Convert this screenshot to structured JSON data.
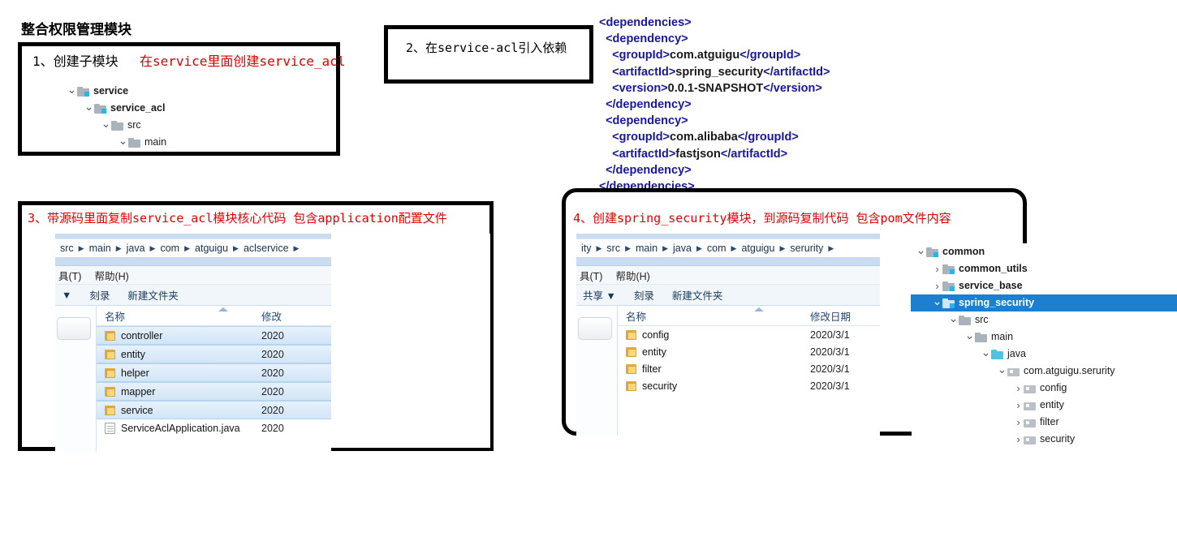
{
  "page_title": "整合权限管理模块",
  "box1": {
    "title": "1、创建子模块",
    "note": "在service里面创建service_acl",
    "tree": [
      {
        "label": "service",
        "indent": 0,
        "arrow": "v",
        "icon": "module-folder-icon",
        "bold": true
      },
      {
        "label": "service_acl",
        "indent": 1,
        "arrow": "v",
        "icon": "module-folder-icon",
        "bold": true
      },
      {
        "label": "src",
        "indent": 2,
        "arrow": "v",
        "icon": "folder-icon",
        "bold": false
      },
      {
        "label": "main",
        "indent": 3,
        "arrow": "v",
        "icon": "folder-icon",
        "bold": false
      }
    ]
  },
  "box2": {
    "title": "2、在service-acl引入依赖"
  },
  "xml": {
    "lines": [
      [
        {
          "t": "tag",
          "v": "<dependencies>"
        }
      ],
      [
        {
          "t": "sp",
          "v": "  "
        },
        {
          "t": "tag",
          "v": "<dependency>"
        }
      ],
      [
        {
          "t": "sp",
          "v": "    "
        },
        {
          "t": "tag",
          "v": "<groupId>"
        },
        {
          "t": "val",
          "v": "com.atguigu"
        },
        {
          "t": "tag",
          "v": "</groupId>"
        }
      ],
      [
        {
          "t": "sp",
          "v": "    "
        },
        {
          "t": "tag",
          "v": "<artifactId>"
        },
        {
          "t": "val",
          "v": "spring_security"
        },
        {
          "t": "tag",
          "v": "</artifactId>"
        }
      ],
      [
        {
          "t": "sp",
          "v": "    "
        },
        {
          "t": "tag",
          "v": "<version>"
        },
        {
          "t": "val",
          "v": "0.0.1-SNAPSHOT"
        },
        {
          "t": "tag",
          "v": "</version>"
        }
      ],
      [
        {
          "t": "sp",
          "v": "  "
        },
        {
          "t": "tag",
          "v": "</dependency>"
        }
      ],
      [
        {
          "t": "sp",
          "v": "  "
        },
        {
          "t": "tag",
          "v": "<dependency>"
        }
      ],
      [
        {
          "t": "sp",
          "v": "    "
        },
        {
          "t": "tag",
          "v": "<groupId>"
        },
        {
          "t": "val",
          "v": "com.alibaba"
        },
        {
          "t": "tag",
          "v": "</groupId>"
        }
      ],
      [
        {
          "t": "sp",
          "v": "    "
        },
        {
          "t": "tag",
          "v": "<artifactId>"
        },
        {
          "t": "val",
          "v": "fastjson"
        },
        {
          "t": "tag",
          "v": "</artifactId>"
        }
      ],
      [
        {
          "t": "sp",
          "v": "  "
        },
        {
          "t": "tag",
          "v": "</dependency>"
        }
      ],
      [
        {
          "t": "tag",
          "v": "</dependencies>"
        }
      ]
    ],
    "tag_color": "#18189c",
    "value_color": "#1a1a1a"
  },
  "box3": {
    "heading": "3、带源码里面复制service_acl模块核心代码  包含application配置文件",
    "explorer": {
      "breadcrumb": [
        "src",
        "main",
        "java",
        "com",
        "atguigu",
        "aclservice"
      ],
      "menu": [
        "具(T)",
        "帮助(H)"
      ],
      "toolbar": [
        "▼",
        "刻录",
        "新建文件夹"
      ],
      "columns": {
        "name": "名称",
        "date": "修改"
      },
      "rows": [
        {
          "name": "controller",
          "date": "2020",
          "icon": "folder-icon",
          "selected": true
        },
        {
          "name": "entity",
          "date": "2020",
          "icon": "folder-icon",
          "selected": true
        },
        {
          "name": "helper",
          "date": "2020",
          "icon": "folder-icon",
          "selected": true
        },
        {
          "name": "mapper",
          "date": "2020",
          "icon": "folder-icon",
          "selected": true
        },
        {
          "name": "service",
          "date": "2020",
          "icon": "folder-icon",
          "selected": true
        },
        {
          "name": "ServiceAclApplication.java",
          "date": "2020",
          "icon": "file-icon",
          "selected": false
        }
      ]
    }
  },
  "box4": {
    "heading": "4、创建spring_security模块，到源码复制代码  包含pom文件内容",
    "explorer": {
      "breadcrumb": [
        "ity",
        "src",
        "main",
        "java",
        "com",
        "atguigu",
        "serurity"
      ],
      "menu": [
        "具(T)",
        "帮助(H)"
      ],
      "toolbar": [
        "共享 ▼",
        "刻录",
        "新建文件夹"
      ],
      "columns": {
        "name": "名称",
        "date": "修改日期"
      },
      "rows": [
        {
          "name": "config",
          "date": "2020/3/1",
          "icon": "folder-icon",
          "selected": false
        },
        {
          "name": "entity",
          "date": "2020/3/1",
          "icon": "folder-icon",
          "selected": false
        },
        {
          "name": "filter",
          "date": "2020/3/1",
          "icon": "folder-icon",
          "selected": false
        },
        {
          "name": "security",
          "date": "2020/3/1",
          "icon": "folder-icon",
          "selected": false
        }
      ]
    },
    "tree": [
      {
        "label": "common",
        "indent": 0,
        "arrow": "v",
        "icon": "module-folder-icon",
        "bold": true,
        "selected": false
      },
      {
        "label": "common_utils",
        "indent": 1,
        "arrow": ">",
        "icon": "module-folder-icon",
        "bold": true,
        "selected": false
      },
      {
        "label": "service_base",
        "indent": 1,
        "arrow": ">",
        "icon": "module-folder-icon",
        "bold": true,
        "selected": false
      },
      {
        "label": "spring_security",
        "indent": 1,
        "arrow": "v",
        "icon": "module-folder-icon",
        "bold": true,
        "selected": true
      },
      {
        "label": "src",
        "indent": 2,
        "arrow": "v",
        "icon": "folder-icon",
        "bold": false,
        "selected": false
      },
      {
        "label": "main",
        "indent": 3,
        "arrow": "v",
        "icon": "folder-icon",
        "bold": false,
        "selected": false
      },
      {
        "label": "java",
        "indent": 4,
        "arrow": "v",
        "icon": "source-folder-icon",
        "bold": false,
        "selected": false
      },
      {
        "label": "com.atguigu.serurity",
        "indent": 5,
        "arrow": "v",
        "icon": "package-icon",
        "bold": false,
        "selected": false
      },
      {
        "label": "config",
        "indent": 6,
        "arrow": ">",
        "icon": "package-icon",
        "bold": false,
        "selected": false
      },
      {
        "label": "entity",
        "indent": 6,
        "arrow": ">",
        "icon": "package-icon",
        "bold": false,
        "selected": false
      },
      {
        "label": "filter",
        "indent": 6,
        "arrow": ">",
        "icon": "package-icon",
        "bold": false,
        "selected": false
      },
      {
        "label": "security",
        "indent": 6,
        "arrow": ">",
        "icon": "package-icon",
        "bold": false,
        "selected": false
      }
    ],
    "selection_color": "#1d7fd0"
  }
}
